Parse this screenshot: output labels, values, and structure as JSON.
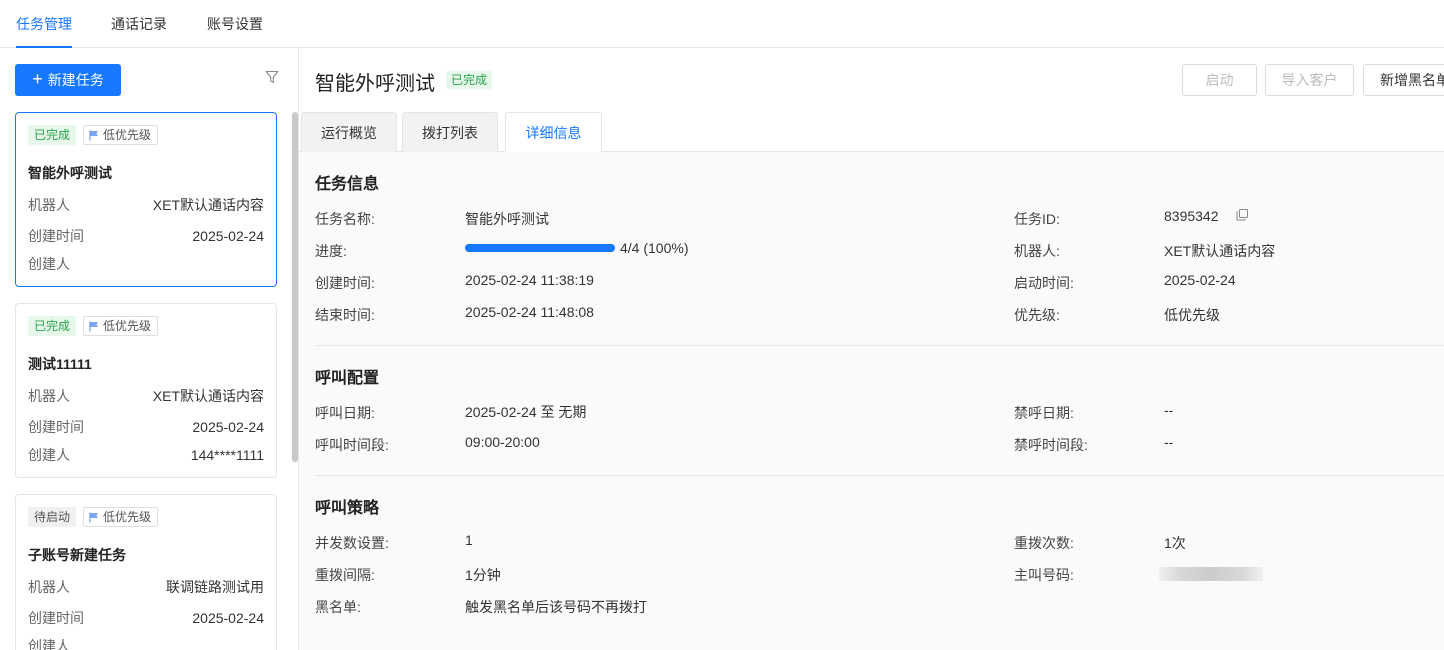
{
  "topnav": {
    "tabs": [
      {
        "label": "任务管理",
        "active": true
      },
      {
        "label": "通话记录",
        "active": false
      },
      {
        "label": "账号设置",
        "active": false
      }
    ]
  },
  "sidebar": {
    "new_task_label": "新建任务",
    "cards": [
      {
        "status": "已完成",
        "priority": "低优先级",
        "title": "智能外呼测试",
        "robot_label": "机器人",
        "robot": "XET默认通话内容",
        "created_label": "创建时间",
        "created": "2025-02-24",
        "creator_label": "创建人",
        "creator": ""
      },
      {
        "status": "已完成",
        "priority": "低优先级",
        "title": "测试11111",
        "robot_label": "机器人",
        "robot": "XET默认通话内容",
        "created_label": "创建时间",
        "created": "2025-02-24",
        "creator_label": "创建人",
        "creator": "144****1111"
      },
      {
        "status": "待启动",
        "priority": "低优先级",
        "title": "子账号新建任务",
        "robot_label": "机器人",
        "robot": "联调链路测试用",
        "created_label": "创建时间",
        "created": "2025-02-24",
        "creator_label": "创建人",
        "creator": ""
      }
    ]
  },
  "header": {
    "title": "智能外呼测试",
    "status": "已完成",
    "buttons": {
      "start": "启动",
      "import": "导入客户",
      "blacklist": "新增黑名单"
    }
  },
  "tabs": [
    {
      "label": "运行概览"
    },
    {
      "label": "拨打列表"
    },
    {
      "label": "详细信息"
    }
  ],
  "task_info": {
    "title": "任务信息",
    "name_label": "任务名称:",
    "name": "智能外呼测试",
    "progress_label": "进度:",
    "progress_text": "4/4 (100%)",
    "progress_value": 1.0,
    "created_label": "创建时间:",
    "created": "2025-02-24 11:38:19",
    "ended_label": "结束时间:",
    "ended": "2025-02-24 11:48:08",
    "id_label": "任务ID:",
    "id": "8395342",
    "robot_label": "机器人:",
    "robot": "XET默认通话内容",
    "started_label": "启动时间:",
    "started": "2025-02-24",
    "priority_label": "优先级:",
    "priority": "低优先级"
  },
  "call_config": {
    "title": "呼叫配置",
    "date_label": "呼叫日期:",
    "date": "2025-02-24 至 无期",
    "period_label": "呼叫时间段:",
    "period": "09:00-20:00",
    "ban_date_label": "禁呼日期:",
    "ban_date": "--",
    "ban_period_label": "禁呼时间段:",
    "ban_period": "--"
  },
  "call_strategy": {
    "title": "呼叫策略",
    "concurrency_label": "并发数设置:",
    "concurrency": "1",
    "interval_label": "重拨间隔:",
    "interval": "1分钟",
    "blacklist_label": "黑名单:",
    "blacklist": "触发黑名单后该号码不再拨打",
    "redial_label": "重拨次数:",
    "redial": "1次",
    "caller_label": "主叫号码:"
  }
}
